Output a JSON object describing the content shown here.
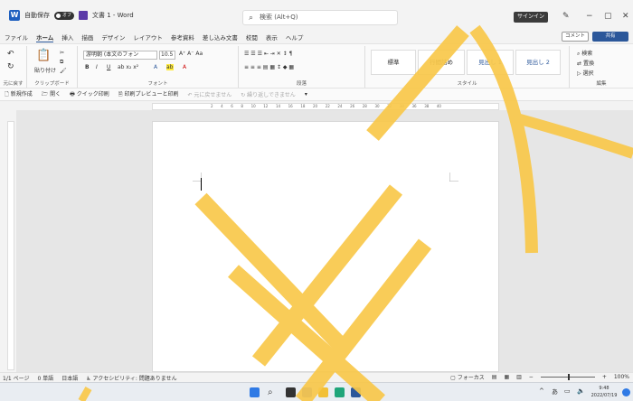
{
  "titlebar": {
    "autosave_label": "自動保存",
    "autosave_state": "オフ",
    "doc_title": "文書 1 - Word",
    "search_placeholder": "検索 (Alt+Q)",
    "signin_label": "サインイン"
  },
  "menu": {
    "items": [
      "ファイル",
      "ホーム",
      "挿入",
      "描画",
      "デザイン",
      "レイアウト",
      "参考資料",
      "差し込み文書",
      "校閲",
      "表示",
      "ヘルプ"
    ],
    "active": "ホーム",
    "comment_label": "コメント",
    "share_label": "共有"
  },
  "ribbon": {
    "undo_group": "元に戻す",
    "clipboard_group": "クリップボード",
    "paste_label": "貼り付け",
    "font_group": "フォント",
    "font_name": "游明朝 (本文のフォン",
    "font_size": "10.5",
    "paragraph_group": "段落",
    "styles_group": "スタイル",
    "styles": [
      "標準",
      "行間詰め",
      "見出し 1",
      "見出し 2"
    ],
    "editing_group": "編集",
    "find_label": "検索",
    "replace_label": "置換",
    "select_label": "選択"
  },
  "qat": {
    "items": [
      "新規作成",
      "開く",
      "クイック印刷",
      "印刷プレビューと印刷"
    ],
    "undo_disabled": "元に戻せません",
    "redo_disabled": "繰り返しできません"
  },
  "ruler": {
    "ticks": [
      "2",
      "4",
      "6",
      "8",
      "10",
      "12",
      "14",
      "16",
      "18",
      "20",
      "22",
      "24",
      "26",
      "28",
      "30",
      "32",
      "34",
      "36",
      "38",
      "40"
    ]
  },
  "statusbar": {
    "page": "1/1 ページ",
    "words": "0 単語",
    "language": "日本語",
    "accessibility": "アクセシビリティ: 問題ありません",
    "focus": "フォーカス",
    "zoom": "100%"
  },
  "taskbar": {
    "time": "9:48",
    "date": "2022/07/19",
    "ime": "あ"
  },
  "colors": {
    "accent": "#2b579a",
    "overlay_stroke": "#f9c84a"
  }
}
